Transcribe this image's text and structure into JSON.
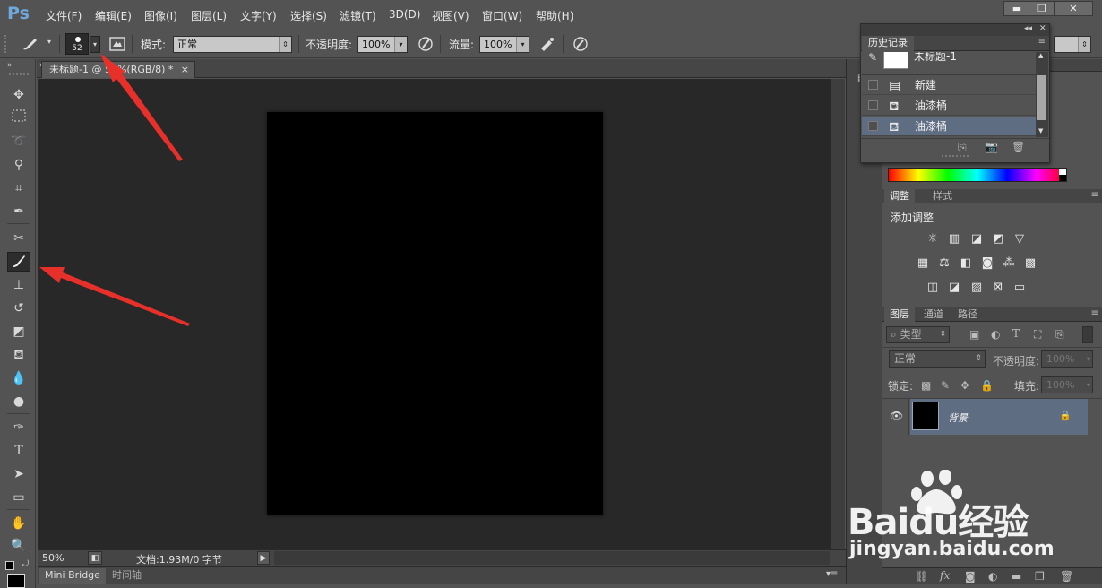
{
  "app": {
    "logo": "Ps"
  },
  "menu": [
    "文件(F)",
    "编辑(E)",
    "图像(I)",
    "图层(L)",
    "文字(Y)",
    "选择(S)",
    "滤镜(T)",
    "3D(D)",
    "视图(V)",
    "窗口(W)",
    "帮助(H)"
  ],
  "window_buttons": {
    "minimize": "▬",
    "restore": "❐",
    "close": "✕"
  },
  "options": {
    "brush_size": "52",
    "mode_label": "模式:",
    "mode_value": "正常",
    "opacity_label": "不透明度:",
    "opacity_value": "100%",
    "flow_label": "流量:",
    "flow_value": "100%"
  },
  "document": {
    "tab_title": "未标题-1 @ 50%(RGB/8) *",
    "tab_close": "×",
    "canvas_color": "#000000"
  },
  "status": {
    "zoom": "50%",
    "doc_info": "文档:1.93M/0 字节"
  },
  "bottom_tabs": [
    "Mini Bridge",
    "时间轴"
  ],
  "history_panel": {
    "title": "历史记录",
    "snapshot_label": "未标题-1",
    "items": [
      {
        "label": "新建",
        "icon": "document-icon",
        "selected": false
      },
      {
        "label": "油漆桶",
        "icon": "paint-bucket-icon",
        "selected": false
      },
      {
        "label": "油漆桶",
        "icon": "paint-bucket-icon",
        "selected": true
      }
    ]
  },
  "adjustments_panel": {
    "tabs": [
      "调整",
      "样式"
    ],
    "active_tab": "调整",
    "heading": "添加调整"
  },
  "layers_panel": {
    "tabs": [
      "图层",
      "通道",
      "路径"
    ],
    "active_tab": "图层",
    "filter_label": "类型",
    "blend_mode": "正常",
    "opacity_label": "不透明度:",
    "opacity_value": "100%",
    "lock_label": "锁定:",
    "fill_label": "填充:",
    "fill_value": "100%",
    "layers": [
      {
        "name": "背景",
        "visible": true,
        "locked": true,
        "thumb_color": "#000000"
      }
    ]
  },
  "watermark": {
    "brand": "Baidu经验",
    "url": "jingyan.baidu.com"
  },
  "colors": {
    "ui_bg": "#535353",
    "canvas_bg": "#282828",
    "selection": "#5f6d83",
    "annotation_arrow": "#e8302a"
  }
}
